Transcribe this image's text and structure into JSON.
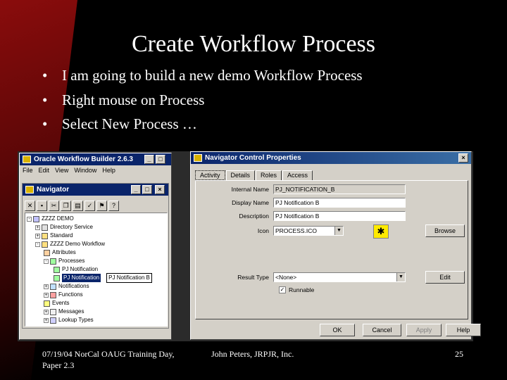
{
  "slide": {
    "title": "Create Workflow Process",
    "bullets": [
      "I am going to build a new demo Workflow Process",
      "Right mouse on Process",
      "Select New Process …"
    ],
    "footer_left": "07/19/04 NorCal OAUG Training Day, Paper 2.3",
    "footer_mid": "John Peters, JRPJR, Inc.",
    "footer_right": "25"
  },
  "builder": {
    "title": "Oracle Workflow Builder 2.6.3",
    "menu": [
      "File",
      "Edit",
      "View",
      "Window",
      "Help"
    ],
    "navigator_title": "Navigator",
    "tree": [
      "ZZZZ DEMO",
      "Directory Service",
      "Standard",
      "ZZZZ Demo Workflow",
      "Attributes",
      "Processes",
      "PJ Notification",
      "PJ Notification",
      "Notifications",
      "Functions",
      "Events",
      "Messages",
      "Lookup Types"
    ],
    "rename_value": "PJ Notification B"
  },
  "props": {
    "title": "Navigator Control Properties",
    "tabs": [
      "Activity",
      "Details",
      "Roles",
      "Access"
    ],
    "internal_name_label": "Internal Name",
    "internal_name": "PJ_NOTIFICATION_B",
    "display_name_label": "Display Name",
    "display_name": "PJ Notification B",
    "description_label": "Description",
    "description": "PJ Notification B",
    "icon_label": "Icon",
    "icon_value": "PROCESS.ICO",
    "browse_label": "Browse",
    "result_type_label": "Result Type",
    "result_type": "<None>",
    "edit_label": "Edit",
    "runnable_label": "Runnable",
    "ok_label": "OK",
    "cancel_label": "Cancel",
    "apply_label": "Apply",
    "help_label": "Help"
  },
  "colors": {
    "titlebar": "#0a246a",
    "window": "#d4d0c8",
    "background": "#000000",
    "accent_red": "#8a0c0c"
  }
}
